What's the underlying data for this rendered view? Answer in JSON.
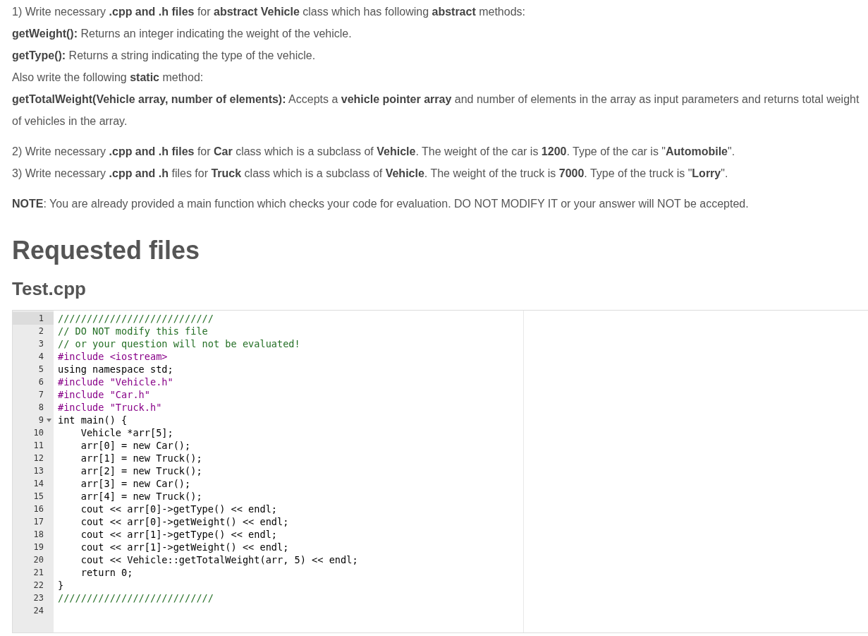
{
  "question": {
    "blocks": [
      {
        "paragraphs": [
          "1) Write necessary **.cpp and .h files** for **abstract Vehicle** class which has following **abstract** methods:",
          "**getWeight():** Returns an integer indicating the weight of the vehicle.",
          "**getType():** Returns a string indicating the type of the vehicle.",
          "Also write the following **static** method:",
          "**getTotalWeight(Vehicle array, number of elements):** Accepts a **vehicle pointer array** and number of elements in the array as input parameters and returns total weight of vehicles in the array."
        ]
      },
      {
        "paragraphs": [
          "2) Write necessary **.cpp and .h files** for **Car** class which is a subclass of **Vehicle**. The weight of the car is **1200**. Type of the car is \"**Automobile**\".",
          "3) Write necessary **.cpp and .h** files for **Truck** class which is a subclass of **Vehicle**. The weight of the truck is **7000**. Type of the truck is \"**Lorry**\"."
        ]
      },
      {
        "paragraphs": [
          "**NOTE**: You are already provided a main function which checks your code for evaluation. DO NOT MODIFY IT or your answer will NOT be accepted."
        ]
      }
    ]
  },
  "heading": "Requested files",
  "file": {
    "name": "Test.cpp",
    "lines": [
      {
        "number": "1",
        "code": "///////////////////////////",
        "kind": "comment",
        "active": true,
        "foldable": false
      },
      {
        "number": "2",
        "code": "// DO NOT modify this file",
        "kind": "comment",
        "active": false,
        "foldable": false
      },
      {
        "number": "3",
        "code": "// or your question will not be evaluated!",
        "kind": "comment",
        "active": false,
        "foldable": false
      },
      {
        "number": "4",
        "code": "#include <iostream>",
        "kind": "directive",
        "active": false,
        "foldable": false
      },
      {
        "number": "5",
        "code": "using namespace std;",
        "kind": "code",
        "active": false,
        "foldable": false
      },
      {
        "number": "6",
        "code": "#include \"Vehicle.h\"",
        "kind": "directive",
        "active": false,
        "foldable": false
      },
      {
        "number": "7",
        "code": "#include \"Car.h\"",
        "kind": "directive",
        "active": false,
        "foldable": false
      },
      {
        "number": "8",
        "code": "#include \"Truck.h\"",
        "kind": "directive",
        "active": false,
        "foldable": false
      },
      {
        "number": "9",
        "code": "int main() {",
        "kind": "code",
        "active": false,
        "foldable": true
      },
      {
        "number": "10",
        "code": "    Vehicle *arr[5];",
        "kind": "code",
        "active": false,
        "foldable": false
      },
      {
        "number": "11",
        "code": "    arr[0] = new Car();",
        "kind": "code",
        "active": false,
        "foldable": false
      },
      {
        "number": "12",
        "code": "    arr[1] = new Truck();",
        "kind": "code",
        "active": false,
        "foldable": false
      },
      {
        "number": "13",
        "code": "    arr[2] = new Truck();",
        "kind": "code",
        "active": false,
        "foldable": false
      },
      {
        "number": "14",
        "code": "    arr[3] = new Car();",
        "kind": "code",
        "active": false,
        "foldable": false
      },
      {
        "number": "15",
        "code": "    arr[4] = new Truck();",
        "kind": "code",
        "active": false,
        "foldable": false
      },
      {
        "number": "16",
        "code": "    cout << arr[0]->getType() << endl;",
        "kind": "code",
        "active": false,
        "foldable": false
      },
      {
        "number": "17",
        "code": "    cout << arr[0]->getWeight() << endl;",
        "kind": "code",
        "active": false,
        "foldable": false
      },
      {
        "number": "18",
        "code": "    cout << arr[1]->getType() << endl;",
        "kind": "code",
        "active": false,
        "foldable": false
      },
      {
        "number": "19",
        "code": "    cout << arr[1]->getWeight() << endl;",
        "kind": "code",
        "active": false,
        "foldable": false
      },
      {
        "number": "20",
        "code": "    cout << Vehicle::getTotalWeight(arr, 5) << endl;",
        "kind": "code",
        "active": false,
        "foldable": false
      },
      {
        "number": "21",
        "code": "    return 0;",
        "kind": "code",
        "active": false,
        "foldable": false
      },
      {
        "number": "22",
        "code": "}",
        "kind": "code",
        "active": false,
        "foldable": false
      },
      {
        "number": "23",
        "code": "///////////////////////////",
        "kind": "comment",
        "active": false,
        "foldable": false
      },
      {
        "number": "24",
        "active": false,
        "foldable": false
      }
    ]
  }
}
